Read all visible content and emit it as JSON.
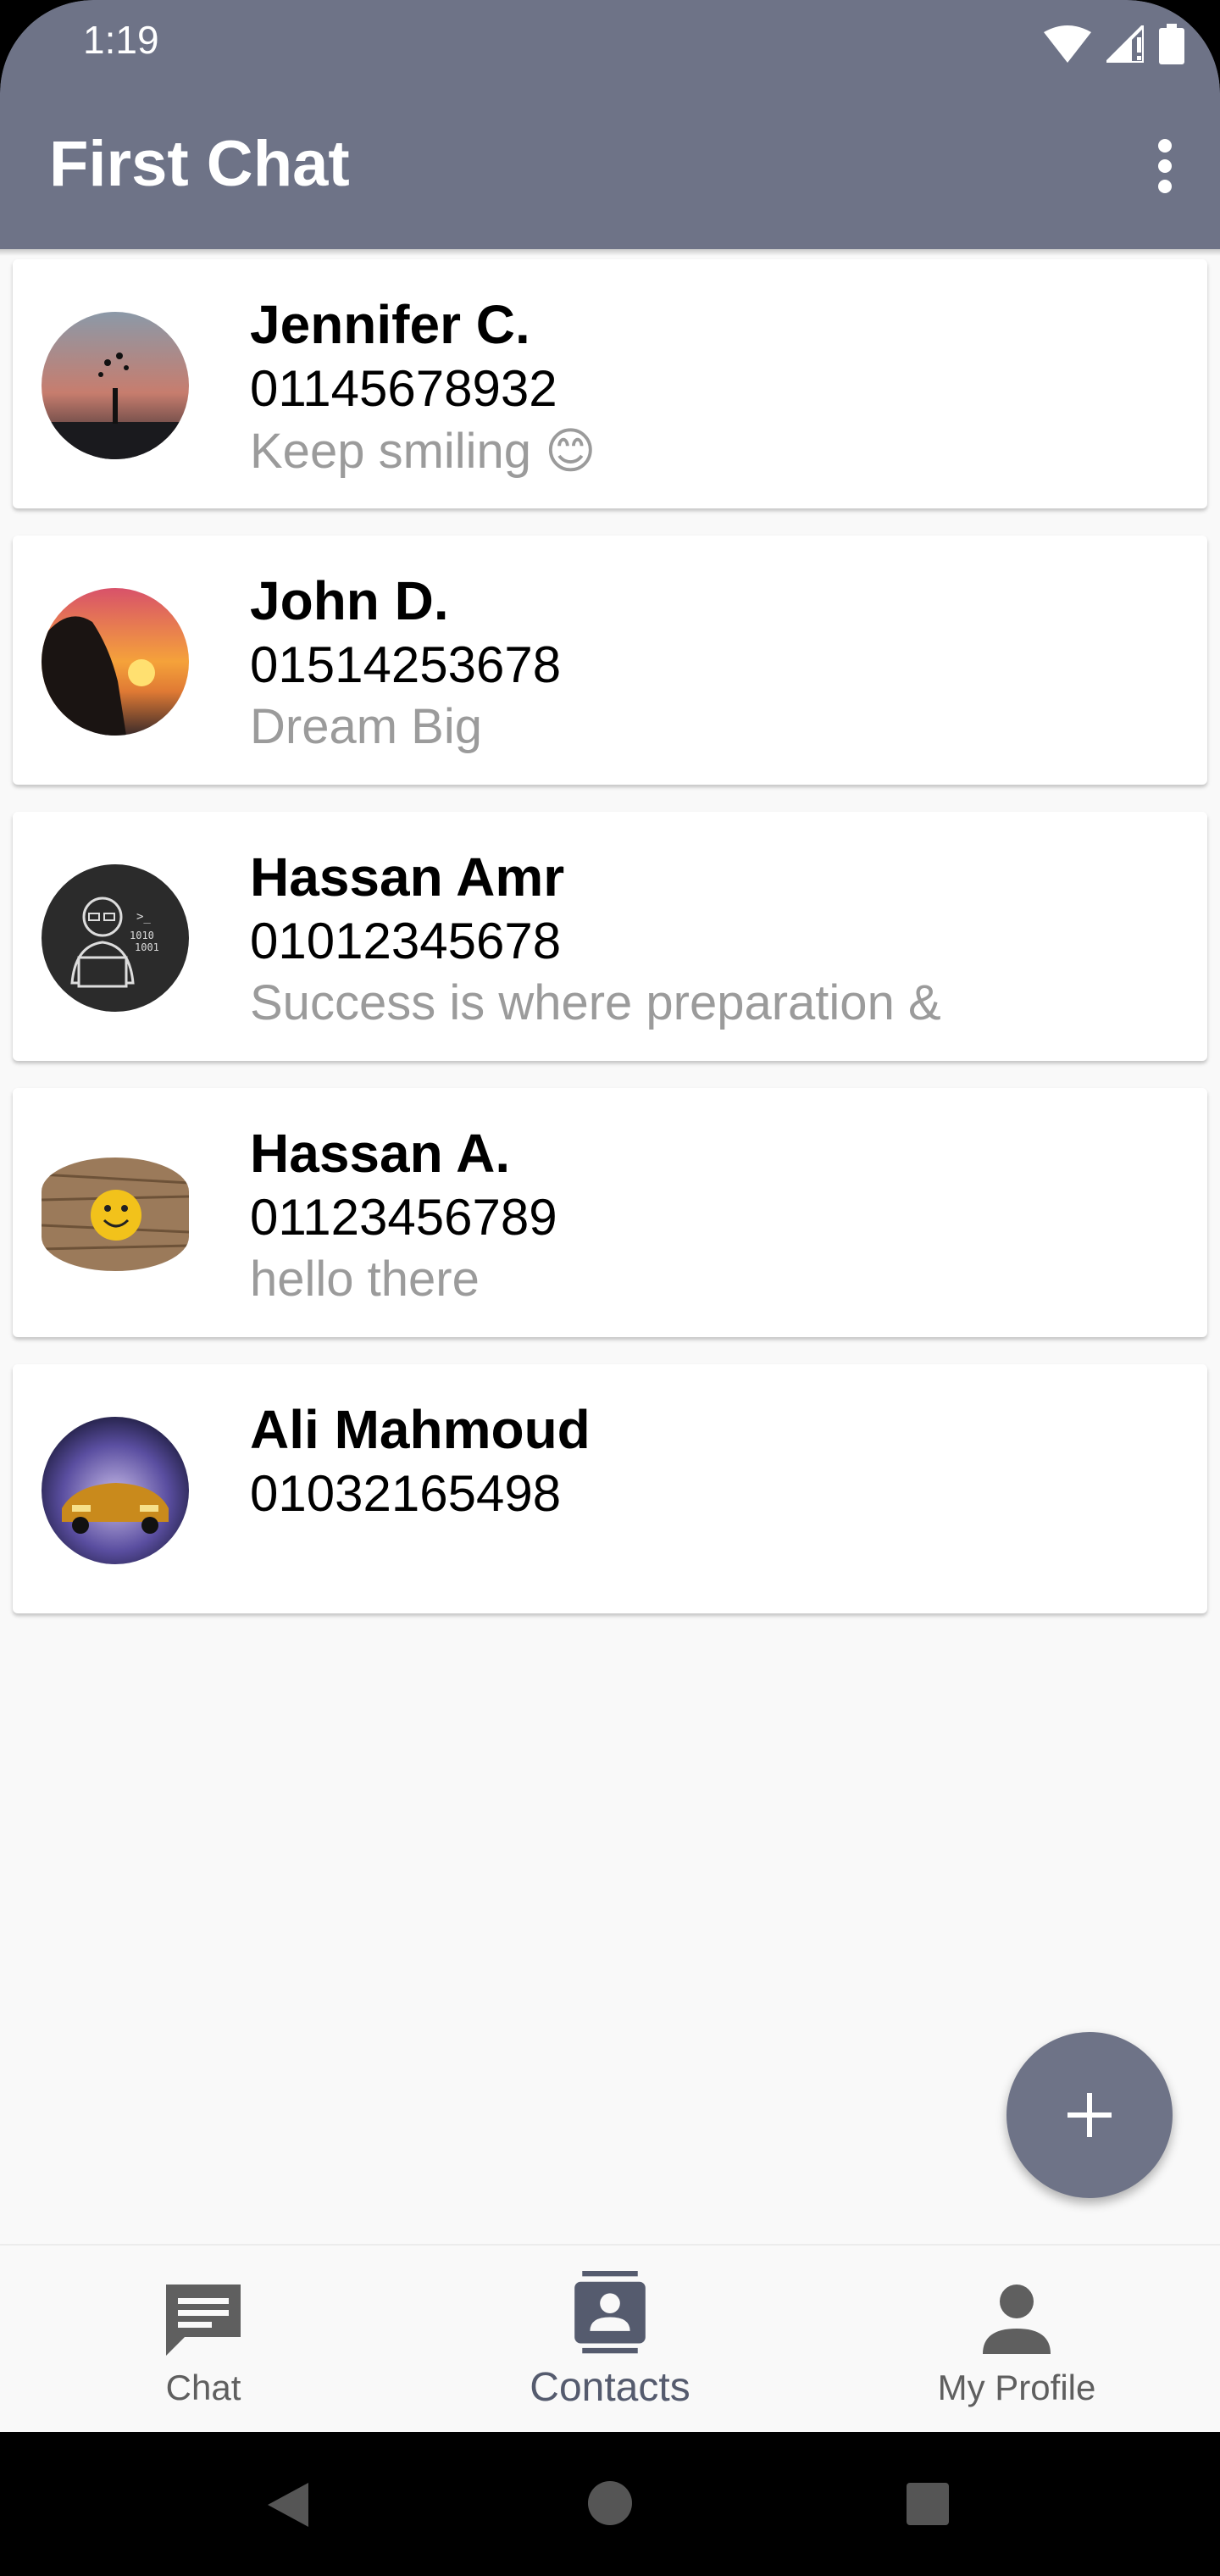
{
  "status_bar": {
    "time": "1:19"
  },
  "app_bar": {
    "title": "First Chat"
  },
  "contacts": [
    {
      "name": "Jennifer C.",
      "phone": "01145678932",
      "status": "Keep smiling 😊"
    },
    {
      "name": "John D.",
      "phone": "01514253678",
      "status": "Dream Big"
    },
    {
      "name": "Hassan Amr",
      "phone": "01012345678",
      "status": "Success is where preparation &"
    },
    {
      "name": "Hassan A.",
      "phone": "01123456789",
      "status": "hello there"
    },
    {
      "name": "Ali Mahmoud",
      "phone": "01032165498",
      "status": ""
    }
  ],
  "bottom_nav": {
    "chat": "Chat",
    "contacts": "Contacts",
    "profile": "My Profile",
    "active": "contacts"
  },
  "colors": {
    "primary": "#6e7387",
    "background": "#f9f9f9"
  }
}
